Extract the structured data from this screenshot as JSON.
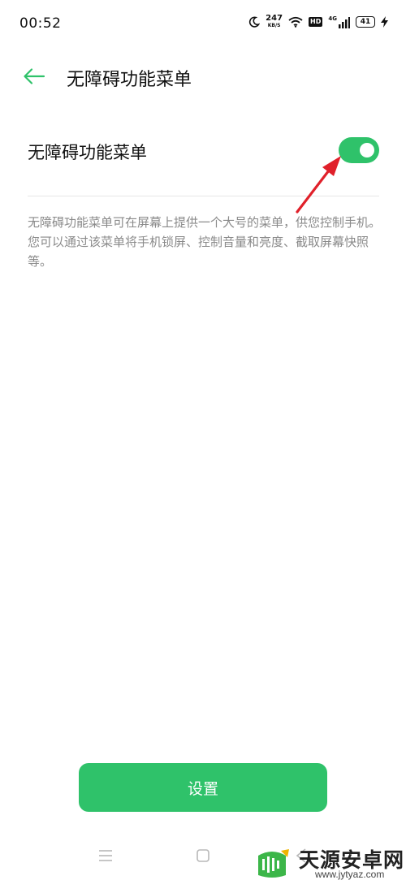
{
  "status_bar": {
    "time": "00:52",
    "net_speed_value": "247",
    "net_speed_unit": "KB/S",
    "hd_label": "HD",
    "network_label": "4G",
    "battery_level": "41"
  },
  "header": {
    "title": "无障碍功能菜单"
  },
  "setting": {
    "label": "无障碍功能菜单",
    "enabled": true,
    "description": "无障碍功能菜单可在屏幕上提供一个大号的菜单，供您控制手机。您可以通过该菜单将手机锁屏、控制音量和亮度、截取屏幕快照等。"
  },
  "button": {
    "label": "设置"
  },
  "watermark": {
    "title": "天源安卓网",
    "url": "www.jytyaz.com"
  },
  "colors": {
    "accent": "#2fc26a",
    "annotation_arrow": "#e0202a"
  }
}
